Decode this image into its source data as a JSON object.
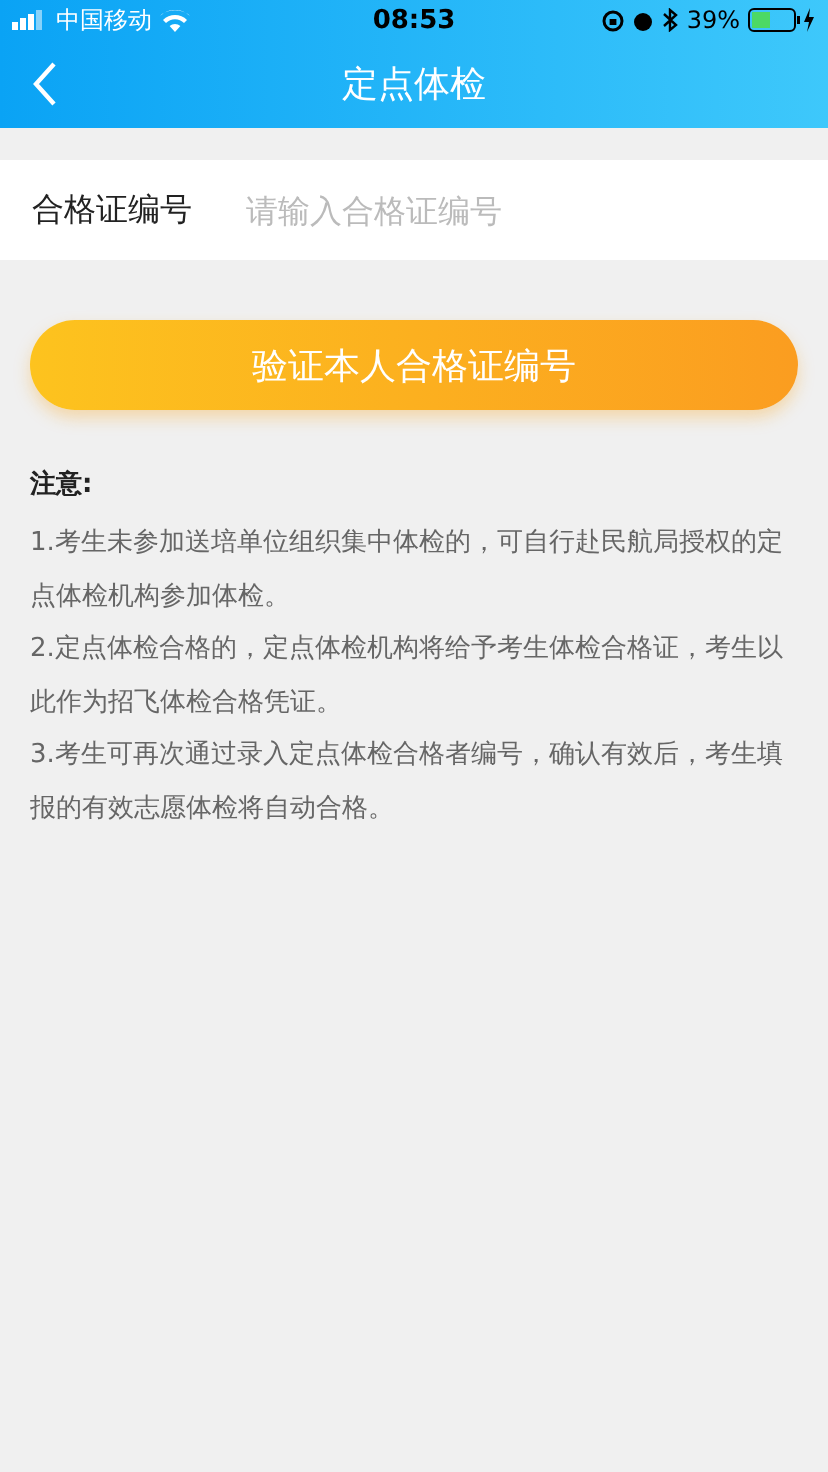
{
  "status_bar": {
    "carrier": "中国移动",
    "time": "08:53",
    "battery": "39%"
  },
  "nav": {
    "title": "定点体检"
  },
  "form": {
    "label": "合格证编号",
    "placeholder": "请输入合格证编号"
  },
  "verify_button": "验证本人合格证编号",
  "notice": {
    "title": "注意:",
    "items": [
      "1.考生未参加送培单位组织集中体检的，可自行赴民航局授权的定点体检机构参加体检。",
      "2.定点体检合格的，定点体检机构将给予考生体检合格证，考生以此作为招飞体检合格凭证。",
      "3.考生可再次通过录入定点体检合格者编号，确认有效后，考生填报的有效志愿体检将自动合格。"
    ]
  }
}
